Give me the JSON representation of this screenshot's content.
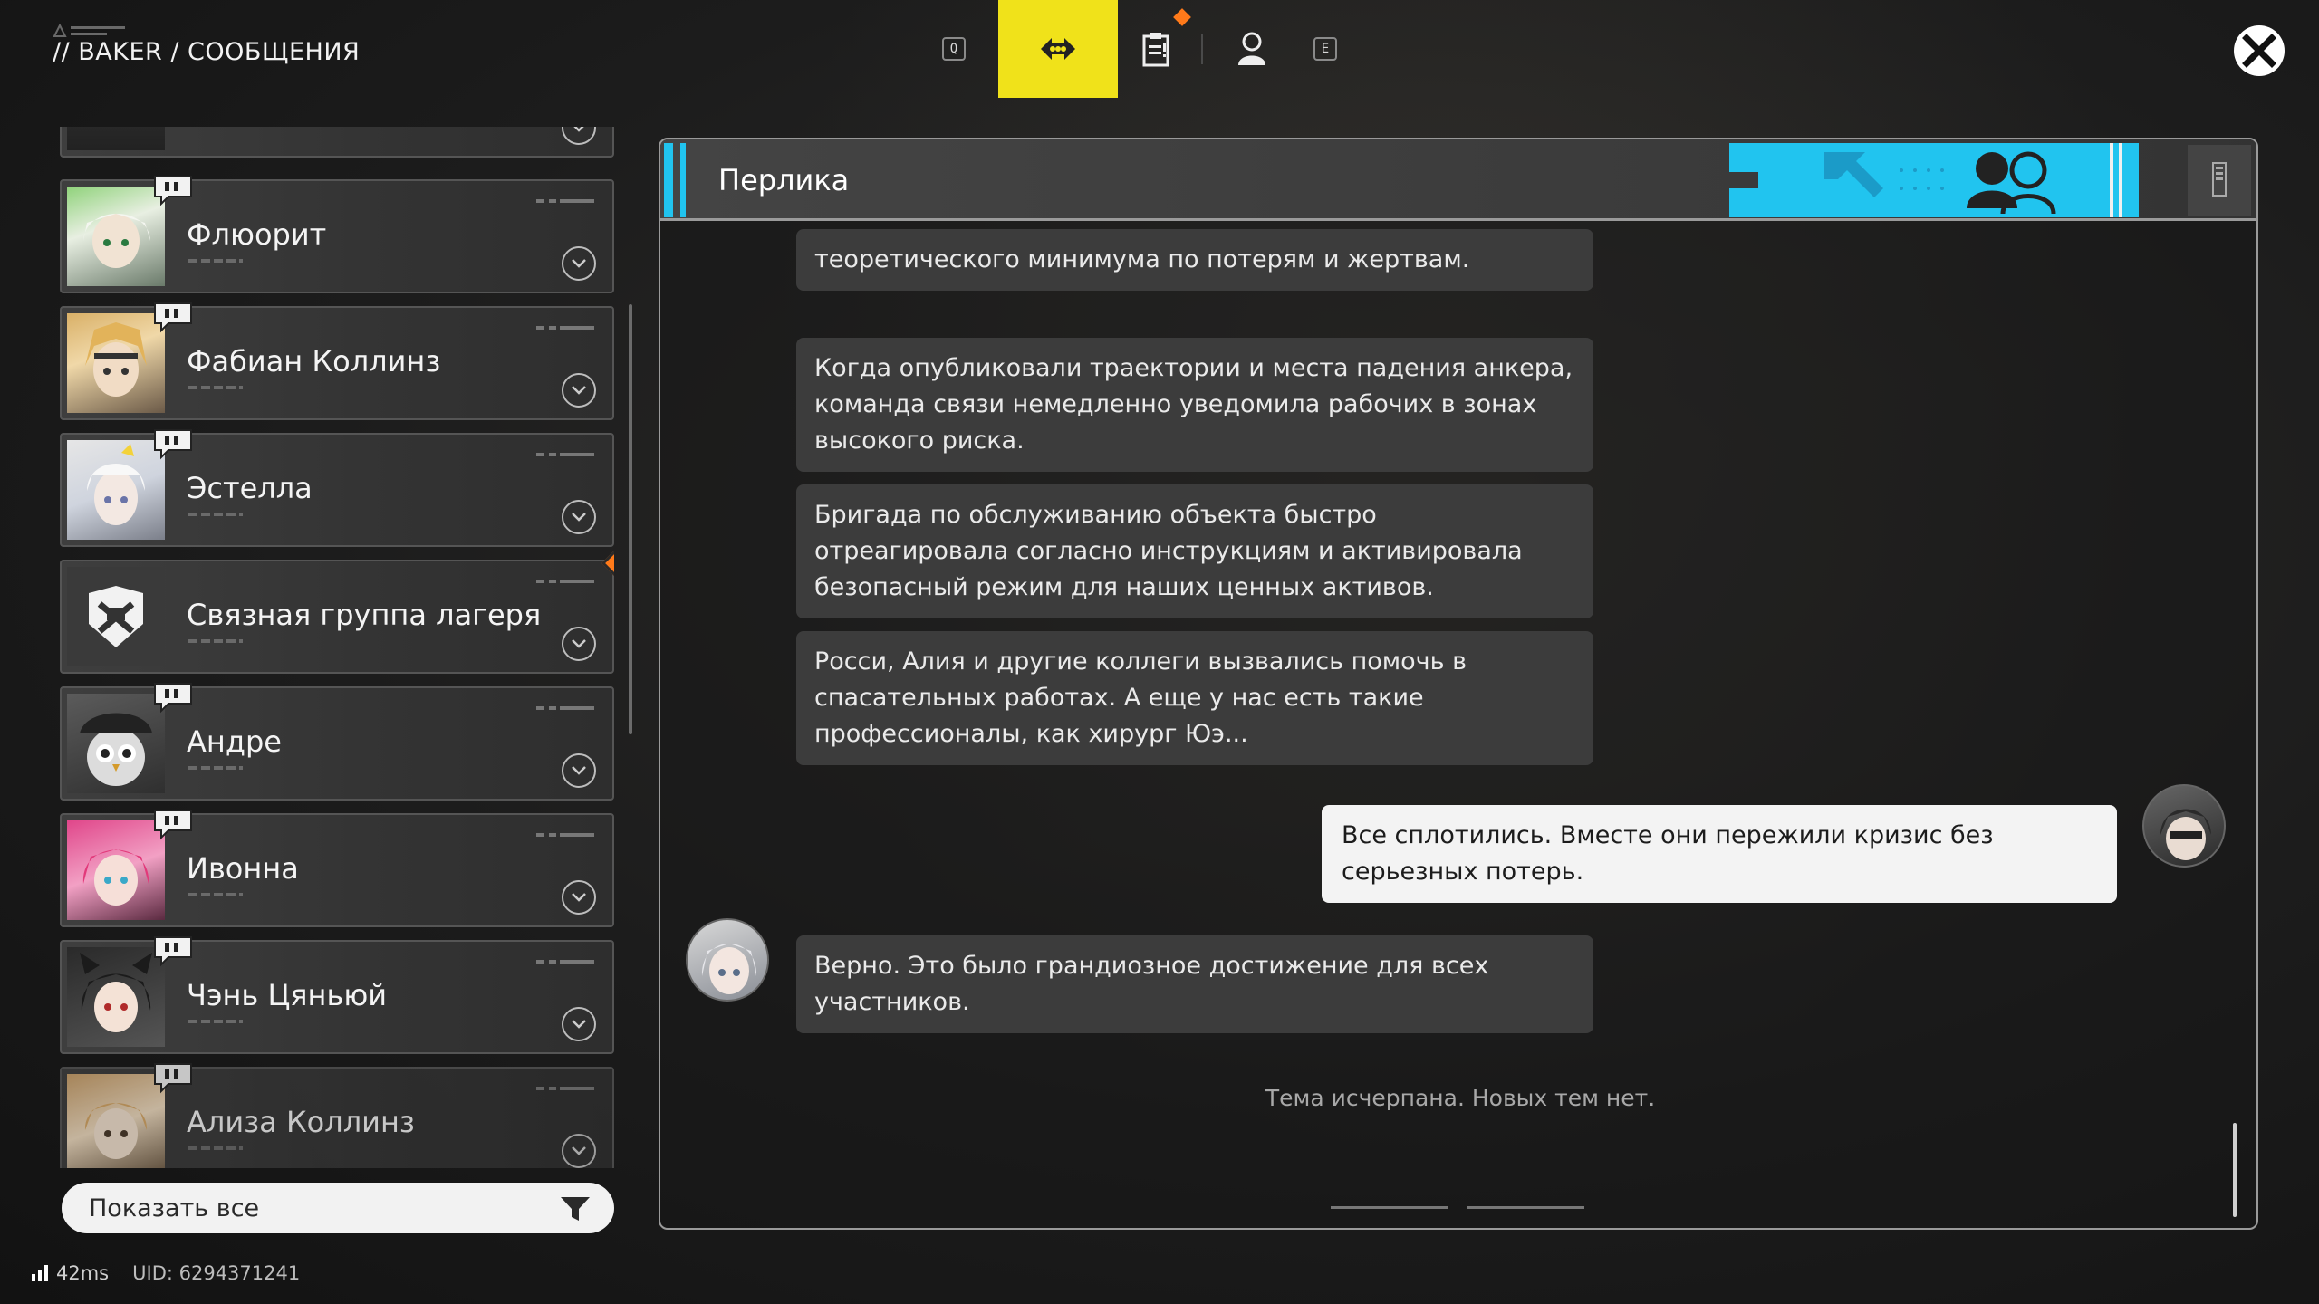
{
  "header": {
    "breadcrumb": "// BAKER / СООБЩЕНИЯ"
  },
  "topnav": {
    "key_left": "Q",
    "key_right": "E",
    "tabs": [
      {
        "icon": "chat-arrows-icon",
        "active": true
      },
      {
        "icon": "quest-log-icon",
        "active": false,
        "notification": true
      },
      {
        "icon": "profile-icon",
        "active": false
      }
    ]
  },
  "contacts": [
    {
      "name": "",
      "partial": true
    },
    {
      "name": "Флюорит",
      "has_message": true
    },
    {
      "name": "Фабиан Коллинз",
      "has_message": true
    },
    {
      "name": "Эстелла",
      "has_message": true
    },
    {
      "name": "Связная группа лагеря",
      "has_message": false,
      "alert": true
    },
    {
      "name": "Андре",
      "has_message": true
    },
    {
      "name": "Ивонна",
      "has_message": true
    },
    {
      "name": "Чэнь Цяньюй",
      "has_message": true
    },
    {
      "name": "Ализа Коллинз",
      "has_message": true
    }
  ],
  "filter": {
    "label": "Показать все"
  },
  "status": {
    "ping": "42ms",
    "uid": "UID: 6294371241"
  },
  "chat": {
    "title": "Перлика",
    "messages": [
      {
        "from": "them",
        "text": "теоретического минимума по потерям и жертвам."
      },
      {
        "from": "them",
        "text": "Когда опубликовали траектории и места падения анкера, команда связи немедленно уведомила рабочих в зонах высокого риска."
      },
      {
        "from": "them",
        "text": "Бригада по обслуживанию объекта быстро отреагировала согласно инструкциям и активировала безопасный режим для наших ценных активов."
      },
      {
        "from": "them",
        "text": "Росси, Алия и другие коллеги вызвались помочь в спасательных работах. А еще у нас есть такие профессионалы, как хирург Юэ..."
      },
      {
        "from": "me",
        "text": "Все сплотились. Вместе они пережили кризис без серьезных потерь."
      },
      {
        "from": "them",
        "text": "Верно. Это было грандиозное достижение для всех участников."
      }
    ],
    "end_notice": "Тема исчерпана. Новых тем нет."
  },
  "colors": {
    "accent_yellow": "#f0e21a",
    "accent_cyan": "#21c4ef",
    "alert_orange": "#ff7a1a"
  }
}
